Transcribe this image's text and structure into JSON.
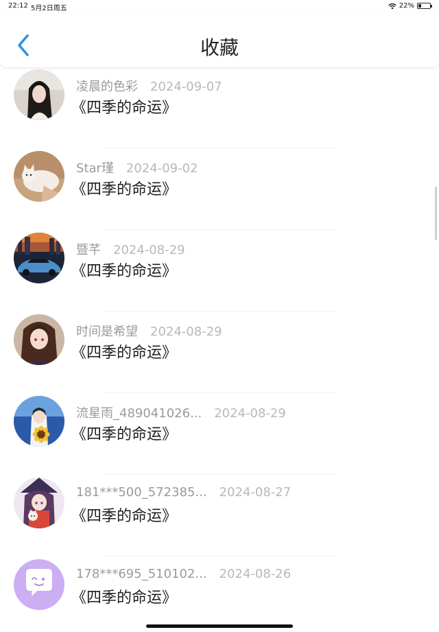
{
  "status_bar": {
    "time": "22:12",
    "date": "5月2日周五",
    "battery": "22%",
    "battery_level": 0.22
  },
  "header": {
    "title": "收藏",
    "accent_color": "#2f8fe6"
  },
  "items": [
    {
      "name": "凌晨的色彩",
      "date": "2024-09-07",
      "work": "《四季的命运》",
      "avatar": "photo-girl-dark-hair"
    },
    {
      "name": "Star瑾",
      "date": "2024-09-02",
      "work": "《四季的命运》",
      "avatar": "photo-white-cat"
    },
    {
      "name": "暨芊",
      "date": "2024-08-29",
      "work": "《四季的命运》",
      "avatar": "photo-sports-car-city"
    },
    {
      "name": "时间是希望",
      "date": "2024-08-29",
      "work": "《四季的命运》",
      "avatar": "anime-girl-brown-hair"
    },
    {
      "name": "流星雨_489041026...",
      "date": "2024-08-29",
      "work": "《四季的命运》",
      "avatar": "anime-boy-sunflower"
    },
    {
      "name": "181***500_572385...",
      "date": "2024-08-27",
      "work": "《四季的命运》",
      "avatar": "anime-girl-witch"
    },
    {
      "name": "178***695_510102...",
      "date": "2024-08-26",
      "work": "《四季的命运》",
      "avatar": "default-chat-bubble-purple"
    }
  ]
}
